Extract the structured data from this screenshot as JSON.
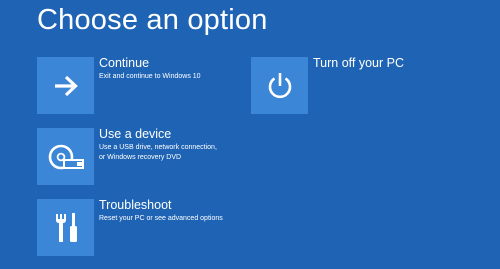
{
  "page": {
    "title": "Choose an option"
  },
  "options": [
    {
      "title": "Continue",
      "desc": [
        "Exit and continue to Windows 10"
      ],
      "icon": "arrow-right-icon"
    },
    {
      "title": "Use a device",
      "desc": [
        "Use a USB drive, network connection,",
        "or Windows recovery DVD"
      ],
      "icon": "disc-usb-icon"
    },
    {
      "title": "Troubleshoot",
      "desc": [
        "Reset your PC or see advanced options"
      ],
      "icon": "tools-icon"
    },
    {
      "title": "Turn off your PC",
      "desc": [],
      "icon": "power-icon"
    }
  ],
  "colors": {
    "background": "#1f64b4",
    "tile": "#3c86d8",
    "text": "#ffffff"
  }
}
